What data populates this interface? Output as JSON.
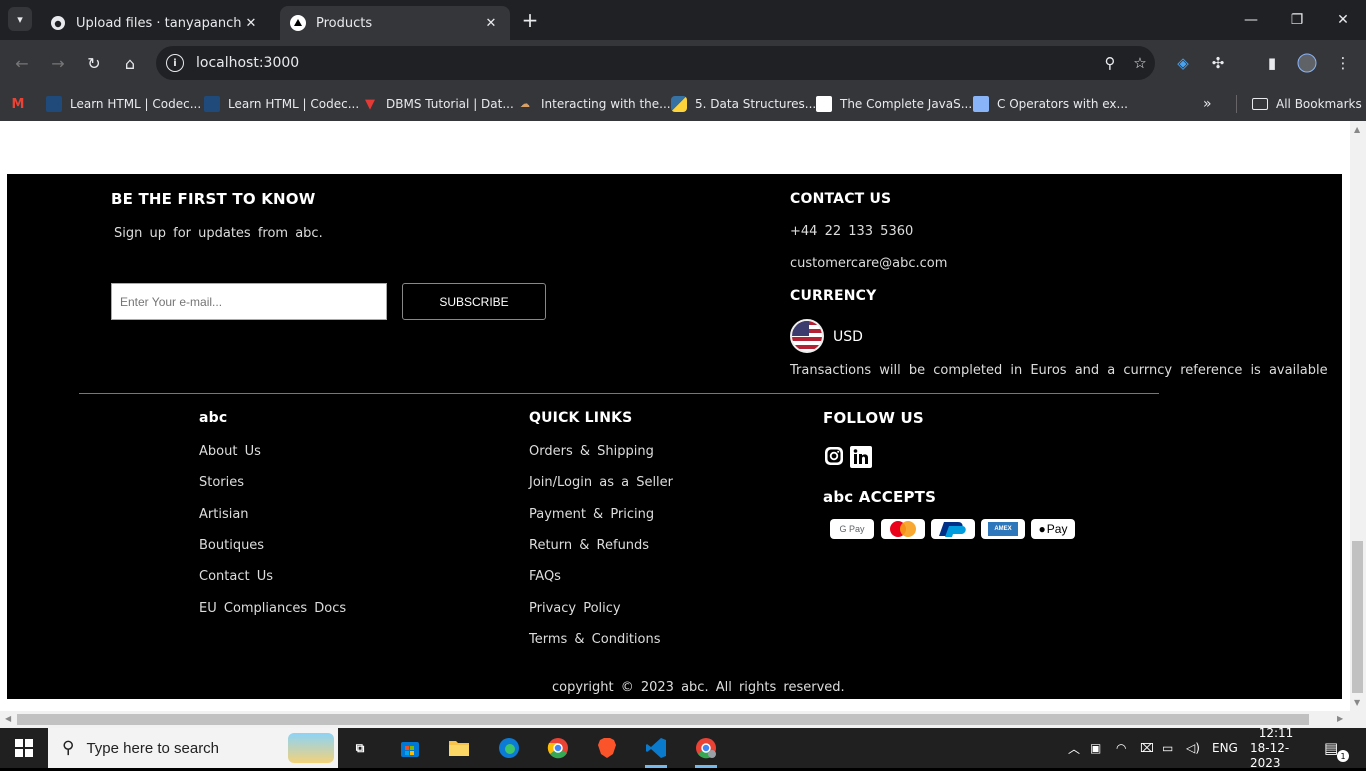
{
  "browser": {
    "tabs": [
      {
        "title": "Upload files · tanyapanchal/App",
        "icon": "github-icon"
      },
      {
        "title": "Products",
        "icon": "vercel-icon"
      }
    ],
    "url": "localhost:3000",
    "bookmarks": [
      {
        "label": "Learn HTML | Codec...",
        "icon": "codecademy-icon"
      },
      {
        "label": "Learn HTML | Codec...",
        "icon": "codecademy-icon"
      },
      {
        "label": "DBMS Tutorial | Dat...",
        "icon": "tutorial-icon"
      },
      {
        "label": "Interacting with the...",
        "icon": "web-icon"
      },
      {
        "label": "5. Data Structures...",
        "icon": "python-icon"
      },
      {
        "label": "The Complete JavaS...",
        "icon": "page-icon"
      },
      {
        "label": "C Operators with ex...",
        "icon": "web-icon"
      }
    ],
    "all_bookmarks": "All Bookmarks"
  },
  "footer": {
    "newsletter": {
      "title": "BE THE FIRST TO KNOW",
      "subtitle": "Sign up for updates from abc.",
      "email_placeholder": "Enter Your e-mail...",
      "subscribe_label": "SUBSCRIBE"
    },
    "contact": {
      "title": "CONTACT US",
      "phone": "+44 22 133 5360",
      "email": "customercare@abc.com"
    },
    "currency": {
      "title": "CURRENCY",
      "code": "USD",
      "note": "Transactions will be completed in Euros and a currncy reference is available"
    },
    "brand": {
      "title": "abc",
      "links": [
        "About Us",
        "Stories",
        "Artisian",
        "Boutiques",
        "Contact Us",
        "EU Compliances Docs"
      ]
    },
    "quick_links": {
      "title": "QUICK LINKS",
      "links": [
        "Orders & Shipping",
        "Join/Login as a Seller",
        "Payment & Pricing",
        "Return & Refunds",
        "FAQs",
        "Privacy Policy",
        "Terms & Conditions"
      ]
    },
    "follow": {
      "title": "FOLLOW US"
    },
    "accepts": {
      "title": "abc ACCEPTS",
      "payments": [
        "G Pay",
        "Mastercard",
        "PayPal",
        "Amex",
        "Apple Pay"
      ],
      "gpay_label": "G Pay",
      "applepay_label": "Pay",
      "amex_label": "AMEX"
    },
    "copyright": "copyright © 2023 abc. All rights reserved."
  },
  "taskbar": {
    "search_placeholder": "Type here to search",
    "language": "ENG",
    "time": "12:11",
    "date": "18-12-2023",
    "notifications": "1"
  }
}
